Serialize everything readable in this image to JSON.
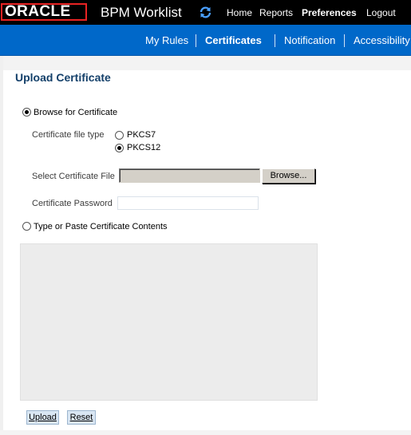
{
  "header": {
    "logo": "ORACLE",
    "app_title": "BPM Worklist",
    "links": {
      "home": "Home",
      "reports": "Reports",
      "preferences": "Preferences",
      "logout": "Logout"
    },
    "colors": {
      "background": "#000000",
      "logo_red": "#e82323"
    }
  },
  "tabs": {
    "items": [
      {
        "label": "My Rules",
        "active": false
      },
      {
        "label": "Certificates",
        "active": true
      },
      {
        "label": "Notification",
        "active": false
      },
      {
        "label": "Accessibility",
        "active": false
      }
    ],
    "color": "#0068c9"
  },
  "page": {
    "title": "Upload Certificate",
    "browse_option": {
      "label": "Browse for Certificate",
      "selected": true
    },
    "file_type": {
      "label": "Certificate file type",
      "options": [
        {
          "label": "PKCS7",
          "selected": false
        },
        {
          "label": "PKCS12",
          "selected": true
        }
      ]
    },
    "select_file": {
      "label": "Select Certificate File",
      "value": "",
      "browse_label": "Browse..."
    },
    "password": {
      "label": "Certificate Password",
      "value": ""
    },
    "paste_option": {
      "label": "Type or Paste Certificate Contents",
      "selected": false
    },
    "contents": {
      "value": ""
    },
    "buttons": {
      "upload": "Upload",
      "reset": "Reset"
    }
  }
}
